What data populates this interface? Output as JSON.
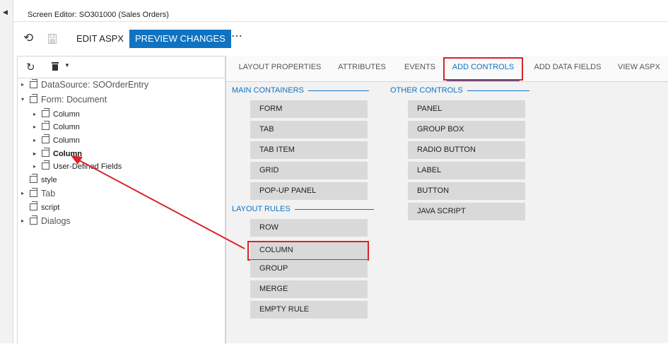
{
  "window": {
    "title": "Screen Editor: SO301000 (Sales Orders)"
  },
  "toolbar": {
    "edit_aspx": "EDIT ASPX",
    "preview_changes": "PREVIEW CHANGES",
    "more": "⋯"
  },
  "tree": {
    "nodes": [
      {
        "label": "DataSource: SOOrderEntry"
      },
      {
        "label": "Form: Document"
      },
      {
        "label": "Column"
      },
      {
        "label": "Column"
      },
      {
        "label": "Column"
      },
      {
        "label": "Column"
      },
      {
        "label": "User-Defined Fields"
      },
      {
        "label": "style"
      },
      {
        "label": "Tab"
      },
      {
        "label": "script"
      },
      {
        "label": "Dialogs"
      }
    ]
  },
  "tabs": [
    {
      "label": "LAYOUT PROPERTIES"
    },
    {
      "label": "ATTRIBUTES"
    },
    {
      "label": "EVENTS"
    },
    {
      "label": "ADD CONTROLS"
    },
    {
      "label": "ADD DATA FIELDS"
    },
    {
      "label": "VIEW ASPX"
    }
  ],
  "main_containers": {
    "title": "MAIN CONTAINERS",
    "items": [
      "FORM",
      "TAB",
      "TAB ITEM",
      "GRID",
      "POP-UP PANEL"
    ]
  },
  "layout_rules": {
    "title": "LAYOUT RULES",
    "items": [
      "ROW",
      "COLUMN",
      "GROUP",
      "MERGE",
      "EMPTY RULE"
    ]
  },
  "other_controls": {
    "title": "OTHER CONTROLS",
    "items": [
      "PANEL",
      "GROUP BOX",
      "RADIO BUTTON",
      "LABEL",
      "BUTTON",
      "JAVA SCRIPT"
    ]
  },
  "colors": {
    "accent": "#0f73c2",
    "highlight": "#d9242a",
    "control_bg": "#d9d9d9"
  },
  "icons": [
    "collapse-left-icon",
    "undo-icon",
    "save-icon",
    "refresh-icon",
    "trash-icon",
    "caret-down-icon",
    "tree-node-icon",
    "expand-arrow-icon"
  ]
}
